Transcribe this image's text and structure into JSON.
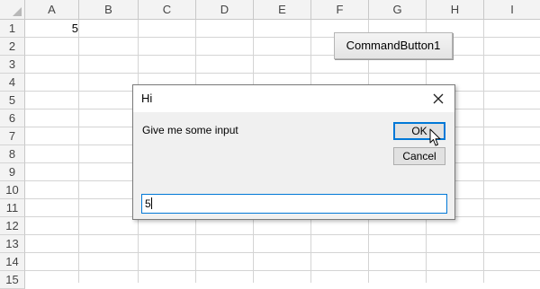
{
  "sheet": {
    "columns": [
      "A",
      "B",
      "C",
      "D",
      "E",
      "F",
      "G",
      "H",
      "I"
    ],
    "rows": [
      "1",
      "2",
      "3",
      "4",
      "5",
      "6",
      "7",
      "8",
      "9",
      "10",
      "11",
      "12",
      "13",
      "14",
      "15"
    ],
    "cell_a1": "5"
  },
  "command_button": {
    "label": "CommandButton1"
  },
  "dialog": {
    "title": "Hi",
    "prompt": "Give me some input",
    "ok_label": "OK",
    "cancel_label": "Cancel",
    "input_value": "5",
    "close_icon": "close-icon"
  },
  "cursor_icon": "mouse-pointer-icon"
}
